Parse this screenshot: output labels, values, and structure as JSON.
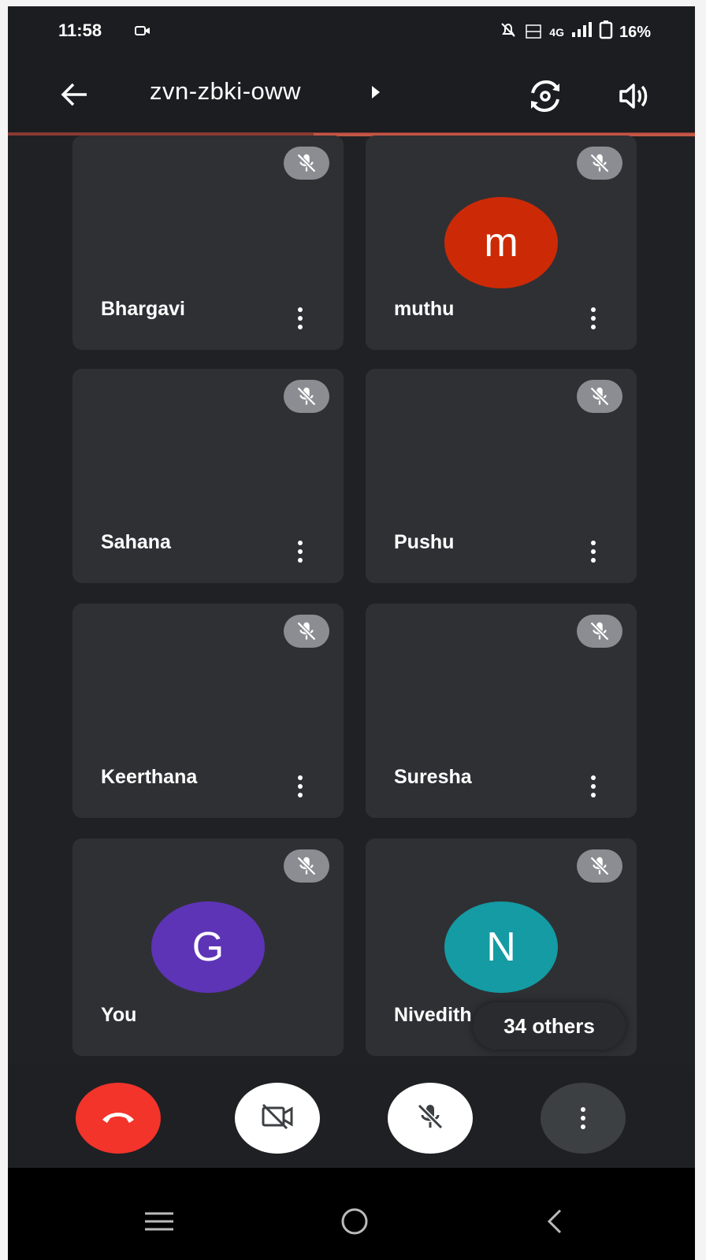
{
  "status_bar": {
    "time": "11:58",
    "network": "4G",
    "battery": "16%",
    "icons": [
      "camera-record-icon",
      "notifications-off-icon",
      "volte-icon",
      "signal-icon",
      "battery-icon"
    ]
  },
  "header": {
    "meeting_code": "zvn-zbki-oww",
    "icons": [
      "back-arrow-icon",
      "expand-triangle-icon",
      "switch-camera-icon",
      "speaker-icon"
    ]
  },
  "participants": [
    {
      "name": "Bhargavi"
    },
    {
      "name": "muthu",
      "avatar_letter": "m",
      "avatar_color": "#cc2a06"
    },
    {
      "name": "Sahana"
    },
    {
      "name": "Pushu"
    },
    {
      "name": "Keerthana"
    },
    {
      "name": "Suresha"
    },
    {
      "name": "You",
      "avatar_letter": "G",
      "avatar_color": "#5d34b6"
    },
    {
      "name": "Nivedith",
      "avatar_letter": "N",
      "avatar_color": "#149ba3"
    }
  ],
  "others_label": "34 others",
  "controls": {
    "end_call_color": "#f2342b",
    "icons": [
      "end-call-icon",
      "camera-off-icon",
      "mic-off-icon",
      "more-options-icon"
    ]
  },
  "nav": {
    "icons": [
      "recent-apps-icon",
      "home-icon",
      "back-icon"
    ]
  }
}
